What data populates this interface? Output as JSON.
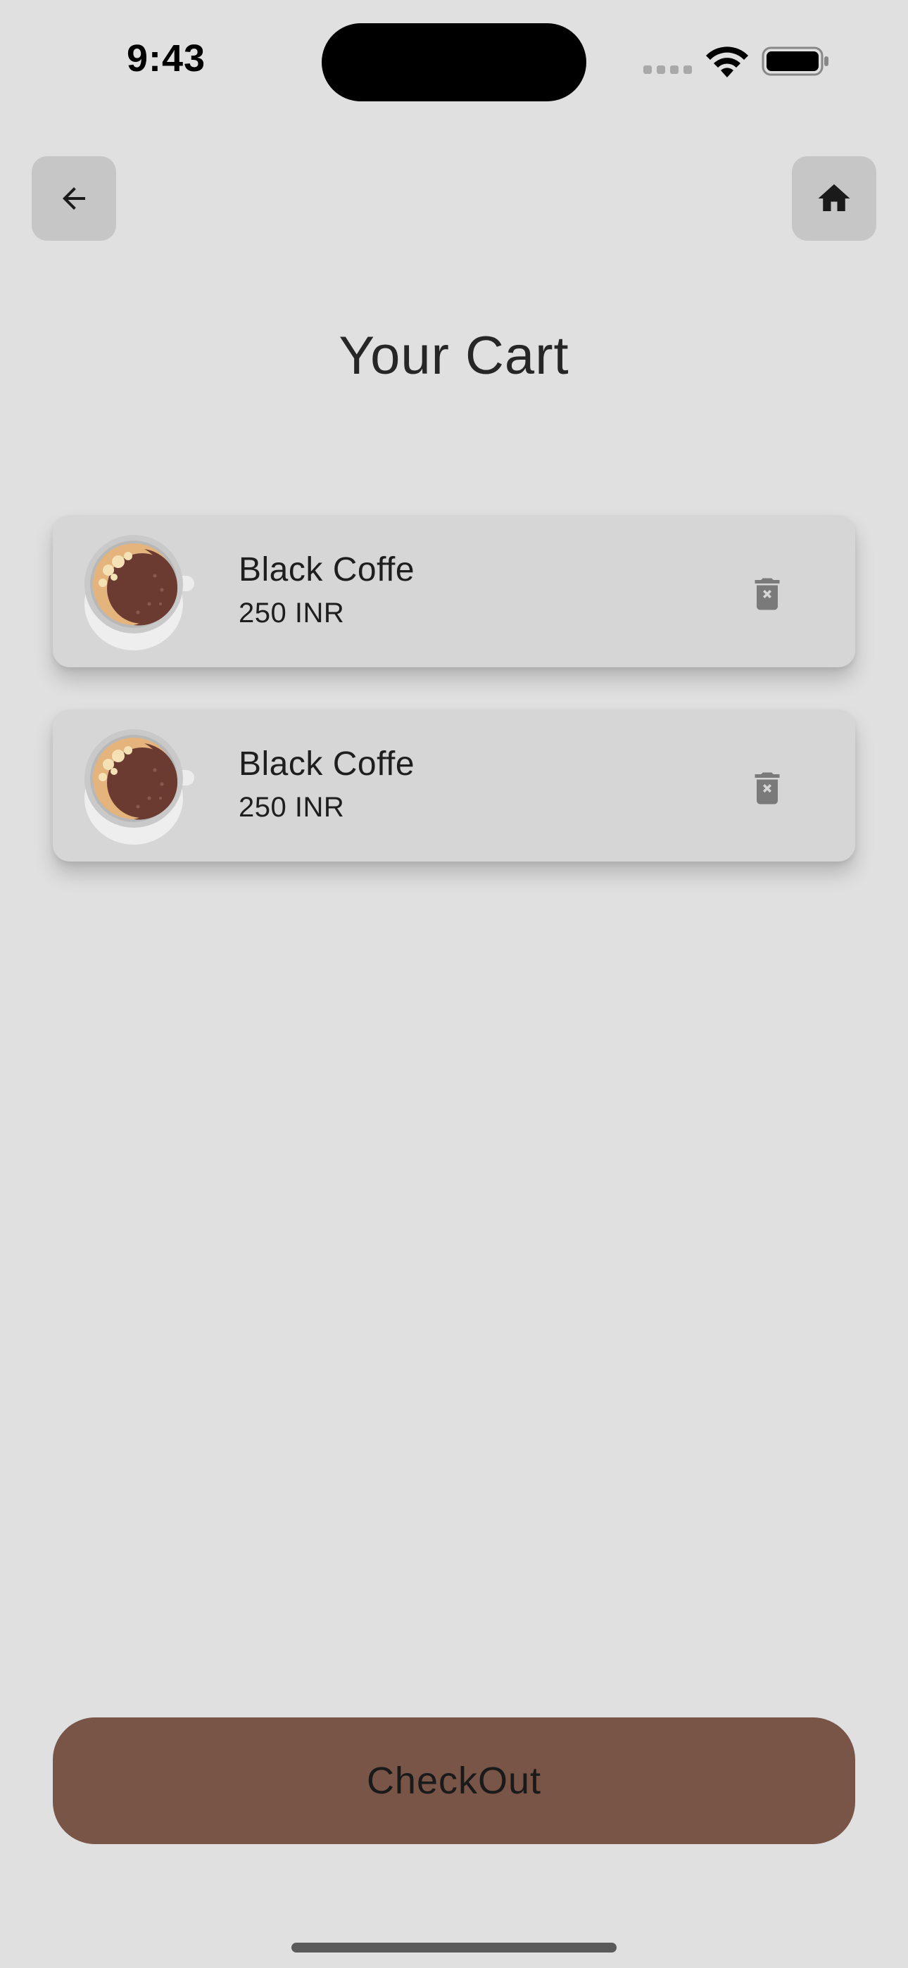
{
  "status_bar": {
    "time": "9:43"
  },
  "nav": {
    "back_icon": "arrow-left-icon",
    "home_icon": "home-icon"
  },
  "page": {
    "title": "Your Cart"
  },
  "cart": {
    "items": [
      {
        "name": "Black Coffe",
        "price": "250 INR",
        "image_icon": "coffee-cup-icon",
        "delete_icon": "delete-icon"
      },
      {
        "name": "Black Coffe",
        "price": "250 INR",
        "image_icon": "coffee-cup-icon",
        "delete_icon": "delete-icon"
      }
    ]
  },
  "checkout": {
    "label": "CheckOut"
  },
  "colors": {
    "background": "#e0e0e0",
    "card": "#d6d6d6",
    "nav_button": "#c6c6c6",
    "checkout_button": "#795548",
    "delete_icon": "#7a7a7a"
  }
}
